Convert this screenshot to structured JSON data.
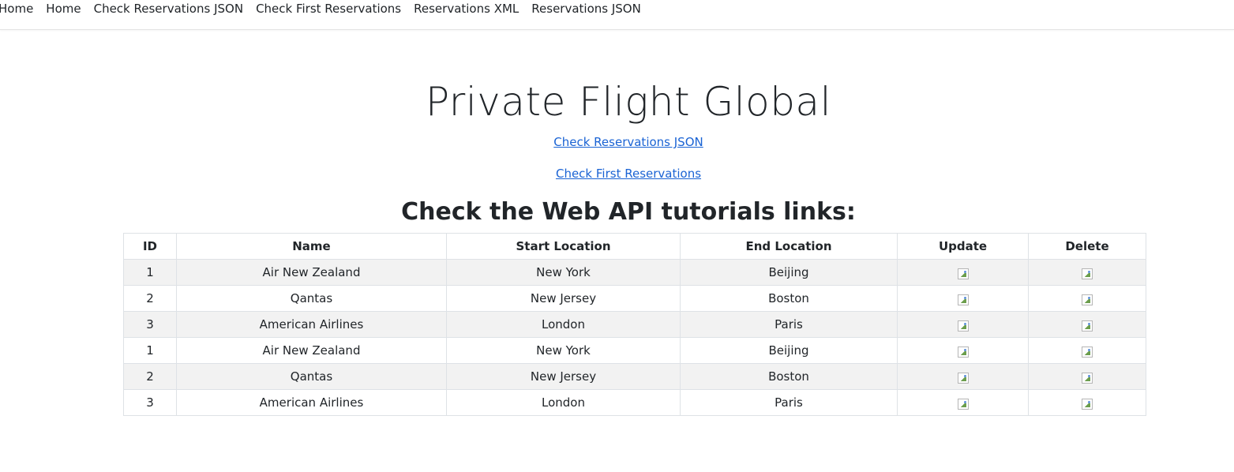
{
  "nav": {
    "items": [
      {
        "label": "Home"
      },
      {
        "label": "Home"
      },
      {
        "label": "Check Reservations JSON"
      },
      {
        "label": "Check First Reservations"
      },
      {
        "label": "Reservations XML"
      },
      {
        "label": "Reservations JSON"
      }
    ]
  },
  "main": {
    "title": "Private Flight Global",
    "link_reservations_json": "Check Reservations JSON",
    "link_first_reservations": "Check First Reservations",
    "tutorial_heading": "Check the Web API tutorials links:"
  },
  "table": {
    "headers": [
      "ID",
      "Name",
      "Start Location",
      "End Location",
      "Update",
      "Delete"
    ],
    "rows": [
      {
        "id": "1",
        "name": "Air New Zealand",
        "start": "New York",
        "end": "Beijing",
        "update_icon": "broken-image-icon",
        "delete_icon": "broken-image-icon"
      },
      {
        "id": "2",
        "name": "Qantas",
        "start": "New Jersey",
        "end": "Boston",
        "update_icon": "broken-image-icon",
        "delete_icon": "broken-image-icon"
      },
      {
        "id": "3",
        "name": "American Airlines",
        "start": "London",
        "end": "Paris",
        "update_icon": "broken-image-icon",
        "delete_icon": "broken-image-icon"
      },
      {
        "id": "1",
        "name": "Air New Zealand",
        "start": "New York",
        "end": "Beijing",
        "update_icon": "broken-image-icon",
        "delete_icon": "broken-image-icon"
      },
      {
        "id": "2",
        "name": "Qantas",
        "start": "New Jersey",
        "end": "Boston",
        "update_icon": "broken-image-icon",
        "delete_icon": "broken-image-icon"
      },
      {
        "id": "3",
        "name": "American Airlines",
        "start": "London",
        "end": "Paris",
        "update_icon": "broken-image-icon",
        "delete_icon": "broken-image-icon"
      }
    ]
  },
  "colors": {
    "link": "#1a63d4",
    "text": "#212529",
    "stripe": "#f2f2f2",
    "border": "#dee2e6"
  }
}
